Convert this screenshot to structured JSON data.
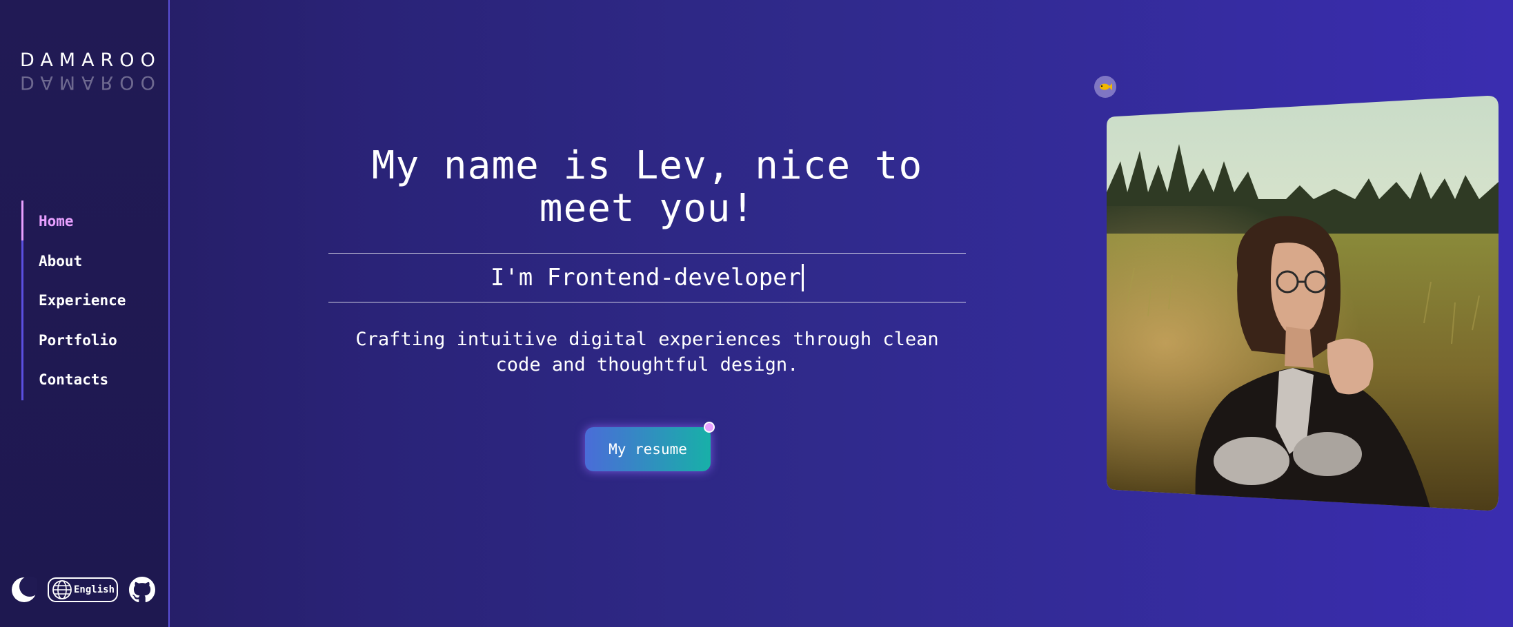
{
  "sidebar": {
    "logo": "DAMAROO",
    "logo_reflection": "DAMAROO",
    "nav": [
      {
        "label": "Home",
        "active": true
      },
      {
        "label": "About",
        "active": false
      },
      {
        "label": "Experience",
        "active": false
      },
      {
        "label": "Portfolio",
        "active": false
      },
      {
        "label": "Contacts",
        "active": false
      }
    ],
    "theme_icon": "moon-icon",
    "language_label": "English",
    "language_icon": "globe-icon",
    "github_icon": "github-icon"
  },
  "hero": {
    "title": "My name is Lev, nice to meet you!",
    "role": "I'm Frontend-developer",
    "tagline": "Crafting intuitive digital experiences through clean code and thoughtful design.",
    "resume_button": "My resume"
  },
  "photo": {
    "badge_icon": "fish-icon"
  },
  "colors": {
    "accent": "#e8a0ff",
    "nav_line": "#5b4fe0",
    "button_start": "#4a6cd8",
    "button_end": "#18b0a8"
  }
}
